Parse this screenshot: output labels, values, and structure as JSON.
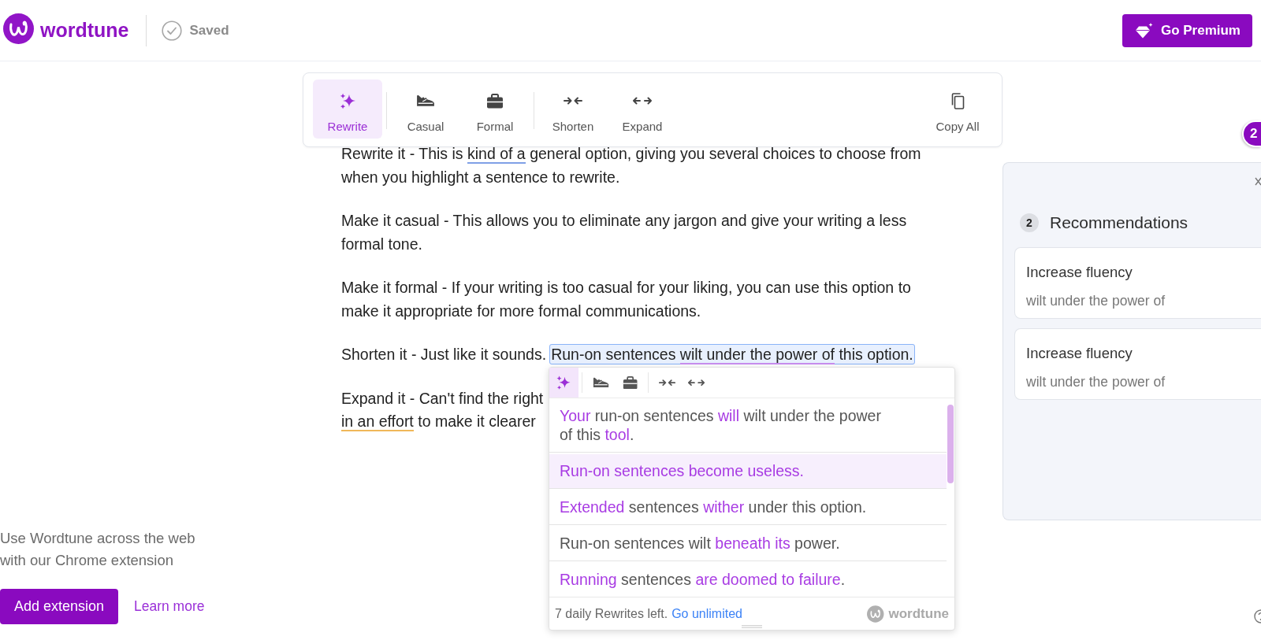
{
  "header": {
    "brand": "wordtune",
    "status": "Saved",
    "premium_button": "Go Premium"
  },
  "toolbar": {
    "groups": [
      [
        {
          "kind": "rewrite",
          "label": "Rewrite",
          "selected": true
        }
      ],
      [
        {
          "kind": "casual",
          "label": "Casual",
          "selected": false
        },
        {
          "kind": "formal",
          "label": "Formal",
          "selected": false
        }
      ],
      [
        {
          "kind": "shorten",
          "label": "Shorten",
          "selected": false
        },
        {
          "kind": "expand",
          "label": "Expand",
          "selected": false
        }
      ]
    ],
    "copy_button": "Copy All"
  },
  "document": {
    "paragraphs": [
      {
        "lines": [
          [
            {
              "kind": "plain",
              "text": "Rewrite it - This is "
            },
            {
              "kind": "underlined",
              "text": "kind of a",
              "color": "#7fa0e6"
            },
            {
              "kind": "plain",
              "text": " general option, giving you several choices to choose from"
            }
          ],
          [
            {
              "kind": "plain",
              "text": "when you highlight a sentence to rewrite."
            }
          ]
        ]
      },
      {
        "lines": [
          [
            {
              "kind": "plain",
              "text": "Make it casual - This allows you to eliminate any jargon and give your writing a less"
            }
          ],
          [
            {
              "kind": "plain",
              "text": "formal tone."
            }
          ]
        ]
      },
      {
        "lines": [
          [
            {
              "kind": "plain",
              "text": "Make it formal - If your writing is too casual for your liking, you can use this option to"
            }
          ],
          [
            {
              "kind": "plain",
              "text": "make it appropriate for more formal communications."
            }
          ]
        ]
      },
      {
        "lines": [
          [
            {
              "kind": "plain",
              "text": "Shorten it - Just like it sounds."
            },
            {
              "kind": "selected",
              "segments": [
                {
                  "kind": "plain",
                  "text": "Run-on sentences "
                },
                {
                  "kind": "underlined",
                  "text": "wilt under the power of",
                  "color": "#c98ff0"
                },
                {
                  "kind": "plain",
                  "text": " this option."
                }
              ]
            }
          ]
        ]
      },
      {
        "lines": [
          [
            {
              "kind": "plain",
              "text": "Expand it - Can't find the right"
            }
          ],
          [
            {
              "kind": "underlined",
              "text": "in an effort",
              "color": "#f0b75a"
            },
            {
              "kind": "plain",
              "text": " to make it clearer"
            }
          ]
        ]
      }
    ]
  },
  "rewrite_popup": {
    "groups": [
      [
        {
          "kind": "rewrite",
          "selected": true
        }
      ],
      [
        {
          "kind": "casual",
          "selected": false
        },
        {
          "kind": "formal",
          "selected": false
        }
      ],
      [
        {
          "kind": "shorten",
          "selected": false
        },
        {
          "kind": "expand",
          "selected": false
        }
      ]
    ],
    "suggestions": [
      {
        "selected": false,
        "segments": [
          {
            "kind": "changed",
            "text": "Your"
          },
          {
            "kind": "kept",
            "text": " run-on sentences "
          },
          {
            "kind": "changed",
            "text": "will"
          },
          {
            "kind": "kept",
            "text": " wilt under the power of this "
          },
          {
            "kind": "changed",
            "text": "tool"
          },
          {
            "kind": "kept",
            "text": "."
          }
        ]
      },
      {
        "selected": true,
        "segments": [
          {
            "kind": "changed",
            "text": "Run-on sentences become useless."
          }
        ]
      },
      {
        "selected": false,
        "segments": [
          {
            "kind": "changed",
            "text": "Extended"
          },
          {
            "kind": "kept",
            "text": " sentences "
          },
          {
            "kind": "changed",
            "text": "wither"
          },
          {
            "kind": "kept",
            "text": " under this option."
          }
        ]
      },
      {
        "selected": false,
        "segments": [
          {
            "kind": "kept",
            "text": "Run-on sentences wilt "
          },
          {
            "kind": "changed",
            "text": "beneath its"
          },
          {
            "kind": "kept",
            "text": " power."
          }
        ]
      },
      {
        "selected": false,
        "segments": [
          {
            "kind": "changed",
            "text": "Running"
          },
          {
            "kind": "kept",
            "text": " sentences "
          },
          {
            "kind": "changed",
            "text": "are doomed to failure"
          },
          {
            "kind": "kept",
            "text": "."
          }
        ]
      }
    ],
    "footer": {
      "note": "7 daily Rewrites left.",
      "link": "Go unlimited",
      "brand": "wordtune"
    }
  },
  "promo": {
    "text": "Use Wordtune across the web with our Chrome extension",
    "button": "Add extension",
    "link": "Learn more"
  },
  "side_badge": "2",
  "recommendations": {
    "count": "2",
    "title": "Recommendations",
    "items": [
      {
        "title": "Increase fluency",
        "detail": "wilt under the power of"
      },
      {
        "title": "Increase fluency",
        "detail": "wilt under the power of"
      }
    ]
  }
}
